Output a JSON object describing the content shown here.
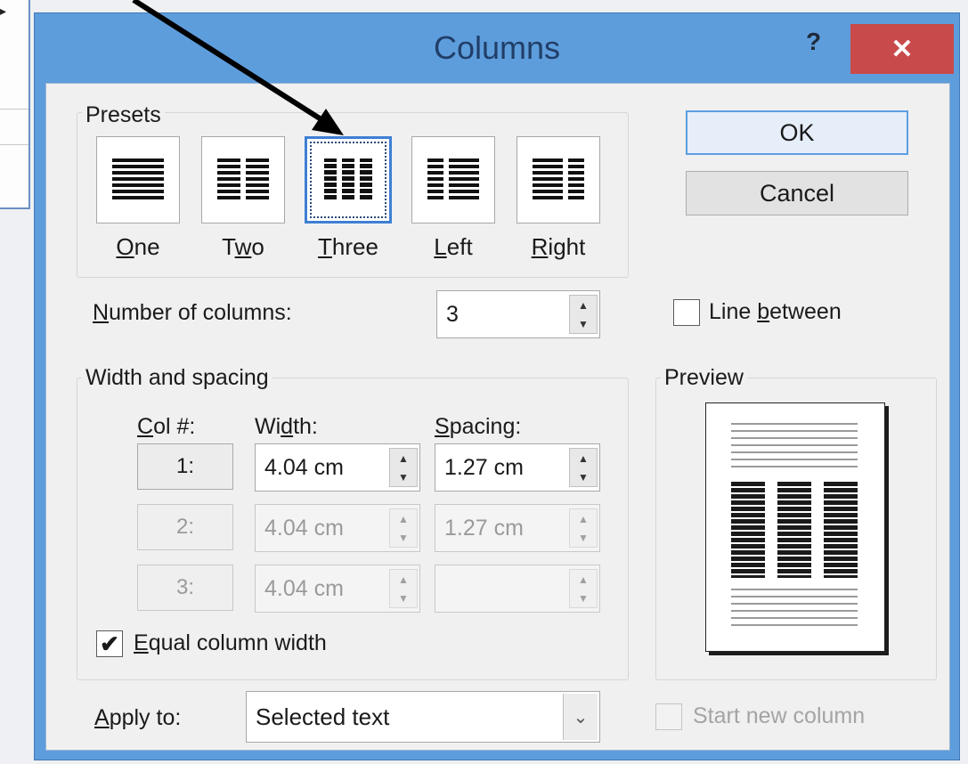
{
  "dialog": {
    "title": "Columns",
    "help_label": "?",
    "close_label": "✕"
  },
  "presets": {
    "group_label": "Presets",
    "items": [
      {
        "label": "One",
        "key": "O",
        "rest": "ne"
      },
      {
        "label": "Two",
        "pre": "T",
        "key": "w",
        "rest": "o"
      },
      {
        "label": "Three",
        "key": "T",
        "rest": "hree",
        "selected": true
      },
      {
        "label": "Left",
        "key": "L",
        "rest": "eft"
      },
      {
        "label": "Right",
        "key": "R",
        "rest": "ight"
      }
    ]
  },
  "buttons": {
    "ok": "OK",
    "cancel": "Cancel"
  },
  "number_of_columns": {
    "label_key": "N",
    "label_rest": "umber of columns:",
    "value": "3"
  },
  "line_between": {
    "label_pre": "Line ",
    "label_key": "b",
    "label_rest": "etween",
    "checked": false
  },
  "width_spacing": {
    "group_label": "Width and spacing",
    "col_header_key": "C",
    "col_header_rest": "ol #:",
    "width_header_pre": "Wi",
    "width_header_key": "d",
    "width_header_rest": "th:",
    "spacing_header_key": "S",
    "spacing_header_rest": "pacing:",
    "rows": [
      {
        "col": "1:",
        "width": "4.04 cm",
        "spacing": "1.27 cm",
        "enabled": true
      },
      {
        "col": "2:",
        "width": "4.04 cm",
        "spacing": "1.27 cm",
        "enabled": false
      },
      {
        "col": "3:",
        "width": "4.04 cm",
        "spacing": "",
        "enabled": false
      }
    ]
  },
  "equal_column_width": {
    "label_key": "E",
    "label_rest": "qual column width",
    "checked": true,
    "check_glyph": "✔"
  },
  "preview": {
    "group_label": "Preview"
  },
  "apply_to": {
    "label_key": "A",
    "label_rest": "pply to:",
    "value": "Selected text",
    "drop_glyph": "⌄"
  },
  "start_new_column": {
    "label": "Start new column",
    "checked": false
  },
  "background_popup": {
    "caret": "▸"
  },
  "colors": {
    "title_bar": "#5e9ddc",
    "close_button": "#c84a4a",
    "selected_border": "#3e7fd4"
  }
}
